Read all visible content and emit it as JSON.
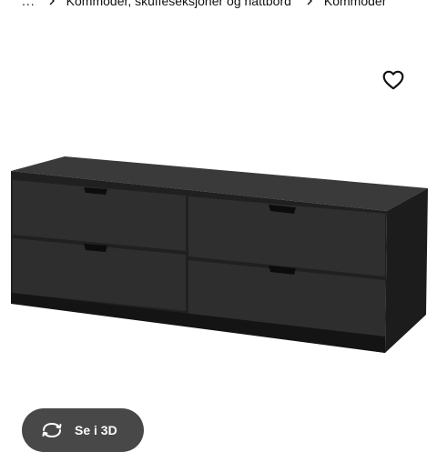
{
  "breadcrumb": {
    "ellipsis": "...",
    "items": [
      "Kommoder, skuffeseksjoner og nattbord",
      "Kommoder"
    ]
  },
  "product": {
    "image_icon": "chest-of-drawers"
  },
  "favorite": {
    "icon": "heart-outline-icon"
  },
  "view3d": {
    "label": "Se i 3D",
    "icon": "rotate-3d-icon"
  },
  "colors": {
    "button_bg": "#484848",
    "furniture": "#2b2b2b",
    "text": "#111111"
  }
}
